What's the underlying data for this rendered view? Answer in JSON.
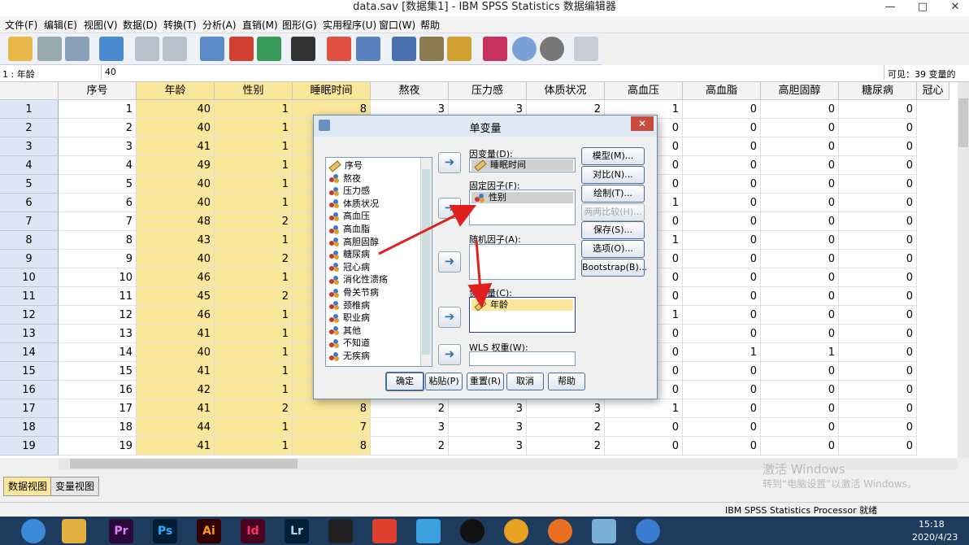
{
  "window": {
    "title": "data.sav [数据集1] - IBM SPSS Statistics 数据编辑器"
  },
  "menu": [
    "文件(F)",
    "编辑(E)",
    "视图(V)",
    "数据(D)",
    "转换(T)",
    "分析(A)",
    "直销(M)",
    "图形(G)",
    "实用程序(U)",
    "窗口(W)",
    "帮助"
  ],
  "cellbar": {
    "ref": "1 : 年龄",
    "value": "40",
    "visible": "可见：39 变量的 39"
  },
  "grid": {
    "columns": [
      "序号",
      "年龄",
      "性别",
      "睡眠时间",
      "熬夜",
      "压力感",
      "体质状况",
      "高血压",
      "高血脂",
      "高胆固醇",
      "糖尿病",
      "冠心"
    ],
    "rows": [
      [
        "1",
        "1",
        "40",
        "1",
        "8",
        "3",
        "3",
        "2",
        "1",
        "0",
        "0",
        "0"
      ],
      [
        "2",
        "2",
        "40",
        "1",
        "",
        "",
        "",
        "",
        "0",
        "0",
        "0",
        "0"
      ],
      [
        "3",
        "3",
        "41",
        "1",
        "",
        "",
        "",
        "",
        "0",
        "0",
        "0",
        "0"
      ],
      [
        "4",
        "4",
        "49",
        "1",
        "",
        "",
        "",
        "",
        "0",
        "0",
        "0",
        "0"
      ],
      [
        "5",
        "5",
        "40",
        "1",
        "",
        "",
        "",
        "",
        "0",
        "0",
        "0",
        "0"
      ],
      [
        "6",
        "6",
        "40",
        "1",
        "",
        "",
        "",
        "",
        "1",
        "0",
        "0",
        "0"
      ],
      [
        "7",
        "7",
        "48",
        "2",
        "",
        "",
        "",
        "",
        "0",
        "0",
        "0",
        "0"
      ],
      [
        "8",
        "8",
        "43",
        "1",
        "",
        "",
        "",
        "",
        "1",
        "0",
        "0",
        "0"
      ],
      [
        "9",
        "9",
        "40",
        "2",
        "",
        "",
        "",
        "",
        "0",
        "0",
        "0",
        "0"
      ],
      [
        "10",
        "10",
        "46",
        "1",
        "",
        "",
        "",
        "",
        "0",
        "0",
        "0",
        "0"
      ],
      [
        "11",
        "11",
        "45",
        "2",
        "",
        "",
        "",
        "",
        "0",
        "0",
        "0",
        "0"
      ],
      [
        "12",
        "12",
        "46",
        "1",
        "",
        "",
        "",
        "",
        "1",
        "0",
        "0",
        "0"
      ],
      [
        "13",
        "13",
        "41",
        "1",
        "",
        "",
        "",
        "",
        "0",
        "0",
        "0",
        "0"
      ],
      [
        "14",
        "14",
        "40",
        "1",
        "",
        "",
        "",
        "",
        "0",
        "1",
        "1",
        "0"
      ],
      [
        "15",
        "15",
        "41",
        "1",
        "",
        "",
        "",
        "",
        "0",
        "0",
        "0",
        "0"
      ],
      [
        "16",
        "16",
        "42",
        "1",
        "",
        "",
        "",
        "",
        "0",
        "0",
        "0",
        "0"
      ],
      [
        "17",
        "17",
        "41",
        "2",
        "8",
        "2",
        "3",
        "3",
        "1",
        "0",
        "0",
        "0"
      ],
      [
        "18",
        "18",
        "44",
        "1",
        "7",
        "3",
        "3",
        "2",
        "0",
        "0",
        "0",
        "0"
      ],
      [
        "19",
        "19",
        "41",
        "1",
        "8",
        "2",
        "3",
        "2",
        "0",
        "0",
        "0",
        "0"
      ]
    ]
  },
  "tabs": {
    "data_view": "数据视图",
    "variable_view": "变量视图"
  },
  "status": {
    "processor": "IBM SPSS Statistics Processor 就绪",
    "watermark1": "激活 Windows",
    "watermark2": "转到“电脑设置”以激活 Windows。"
  },
  "taskbar": {
    "time": "15:18",
    "date": "2020/4/23",
    "apps": [
      "Pr",
      "Ps",
      "Ai",
      "Id",
      "Lr"
    ]
  },
  "dialog": {
    "title": "单变量",
    "variables": [
      "序号",
      "熬夜",
      "压力感",
      "体质状况",
      "高血压",
      "高血脂",
      "高胆固醇",
      "糖尿病",
      "冠心病",
      "消化性溃疡",
      "骨关节病",
      "颈椎病",
      "职业病",
      "其他",
      "不知道",
      "无疾病"
    ],
    "dependent_label": "因变量(D):",
    "dependent_value": "睡眠时间",
    "fixed_label": "固定因子(F):",
    "fixed_value": "性别",
    "random_label": "随机因子(A):",
    "covariate_label": "协变量(C):",
    "covariate_value": "年龄",
    "wls_label": "WLS 权重(W):",
    "side_buttons": [
      "模型(M)...",
      "对比(N)...",
      "绘制(T)...",
      "两两比较(H)...",
      "保存(S)...",
      "选项(O)...",
      "Bootstrap(B)..."
    ],
    "bottom_buttons": [
      "确定",
      "粘贴(P)",
      "重置(R)",
      "取消",
      "帮助"
    ]
  },
  "colors": {
    "selected_column": "#fbe79a",
    "row_header": "#dce6f4",
    "arrow": "#e02020",
    "taskbar": "#1d3b5c"
  }
}
